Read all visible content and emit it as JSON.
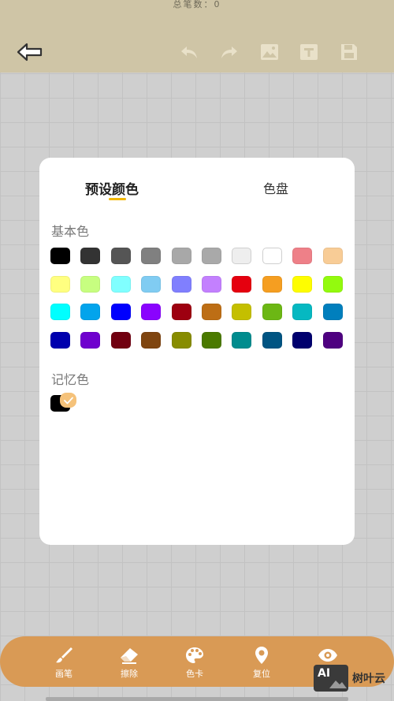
{
  "topbar": {
    "stroke_count": "总笔数：0",
    "icons": [
      "back-arrow-icon",
      "undo-icon",
      "redo-icon",
      "image-icon",
      "text-icon",
      "save-icon"
    ]
  },
  "dialog": {
    "tabs": [
      {
        "label": "预设颜色",
        "active": true
      },
      {
        "label": "色盘",
        "active": false
      }
    ],
    "basic_title": "基本色",
    "basic_colors": [
      [
        "#000000",
        "#333333",
        "#555555",
        "#808080",
        "#a8a8a8",
        "#a9a9a9",
        "#eeeeee",
        "#ffffff",
        "#ee8088",
        "#f8cc96"
      ],
      [
        "#ffff80",
        "#c7fe80",
        "#80ffff",
        "#80ccf2",
        "#807ffe",
        "#c380fe",
        "#e5000f",
        "#f59e21",
        "#fefd00",
        "#93fa0e"
      ],
      [
        "#00ffff",
        "#02a4ec",
        "#0000fe",
        "#8a03fe",
        "#9d0010",
        "#bd6e15",
        "#c4bf00",
        "#6cb714",
        "#06b8c1",
        "#007fbd"
      ],
      [
        "#0000ae",
        "#6f01ce",
        "#710010",
        "#7f4510",
        "#878c00",
        "#4b7a00",
        "#008c8e",
        "#005482",
        "#00006e",
        "#4e0080"
      ]
    ],
    "memory_title": "记忆色",
    "memory_colors": [
      "#000000"
    ],
    "accent_color": "#f2b705"
  },
  "bottombar": {
    "items": [
      {
        "label": "画笔",
        "icon": "brush-icon"
      },
      {
        "label": "擦除",
        "icon": "eraser-icon"
      },
      {
        "label": "色卡",
        "icon": "palette-icon"
      },
      {
        "label": "复位",
        "icon": "location-pin-icon"
      },
      {
        "label": "",
        "icon": "eye-icon"
      }
    ],
    "color": "#d99a55"
  },
  "watermark": {
    "logo_text": "AI",
    "text": "树叶云"
  }
}
